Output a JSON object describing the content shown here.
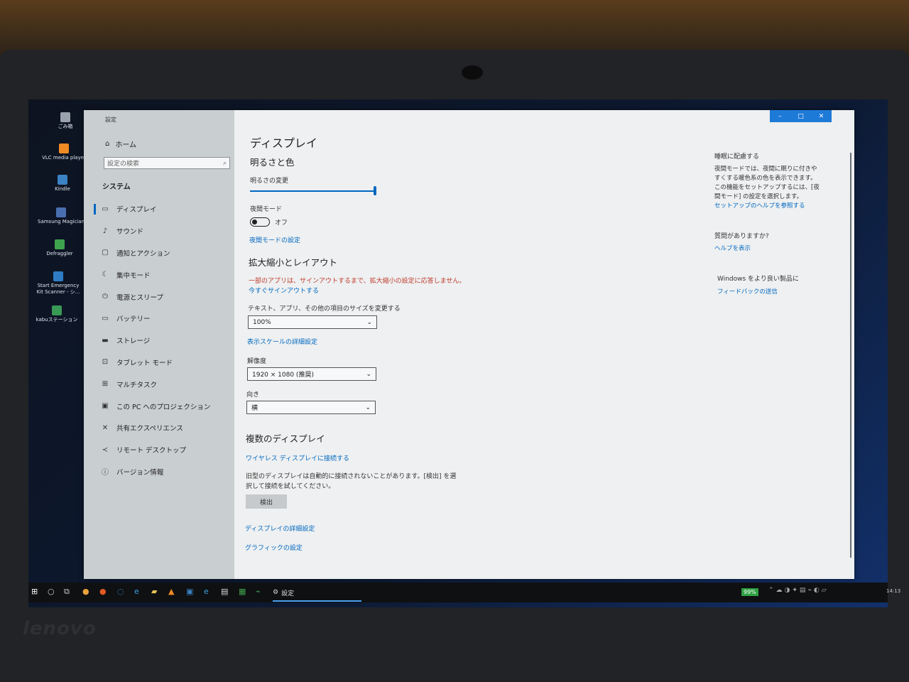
{
  "desktop_icons": [
    {
      "label": "ごみ箱",
      "icon": "recycle-bin-icon"
    },
    {
      "label": "VLC media player",
      "icon": "vlc-icon"
    },
    {
      "label": "Kindle",
      "icon": "kindle-icon"
    },
    {
      "label": "Samsung Magician",
      "icon": "samsung-icon"
    },
    {
      "label": "Defraggler",
      "icon": "defraggler-icon"
    },
    {
      "label": "Start Emergency Kit Scanner - シ...",
      "icon": "scanner-icon"
    },
    {
      "label": "kabuステーション",
      "icon": "kabu-icon"
    }
  ],
  "window": {
    "title": "設定",
    "minimize": "–",
    "maximize": "□",
    "close": "✕"
  },
  "sidebar": {
    "home": "ホーム",
    "search_placeholder": "設定の検索",
    "section": "システム",
    "items": [
      {
        "label": "ディスプレイ",
        "icon": "display-icon"
      },
      {
        "label": "サウンド",
        "icon": "sound-icon"
      },
      {
        "label": "通知とアクション",
        "icon": "notification-icon"
      },
      {
        "label": "集中モード",
        "icon": "focus-moon-icon"
      },
      {
        "label": "電源とスリープ",
        "icon": "power-icon"
      },
      {
        "label": "バッテリー",
        "icon": "battery-icon"
      },
      {
        "label": "ストレージ",
        "icon": "storage-icon"
      },
      {
        "label": "タブレット モード",
        "icon": "tablet-icon"
      },
      {
        "label": "マルチタスク",
        "icon": "multitask-icon"
      },
      {
        "label": "この PC へのプロジェクション",
        "icon": "projection-icon"
      },
      {
        "label": "共有エクスペリエンス",
        "icon": "share-icon"
      },
      {
        "label": "リモート デスクトップ",
        "icon": "remote-icon"
      },
      {
        "label": "バージョン情報",
        "icon": "info-icon"
      }
    ]
  },
  "main": {
    "title": "ディスプレイ",
    "brightness_heading": "明るさと色",
    "brightness_label": "明るさの変更",
    "brightness_value": 1.0,
    "night_label": "夜間モード",
    "night_state": "オフ",
    "night_settings_link": "夜間モードの設定",
    "scale_heading": "拡大縮小とレイアウト",
    "scale_warning": "一部のアプリは、サインアウトするまで、拡大縮小の設定に応答しません。",
    "signout_link": "今すぐサインアウトする",
    "size_label": "テキスト、アプリ、その他の項目のサイズを変更する",
    "size_value": "100%",
    "advanced_scale_link": "表示スケールの詳細設定",
    "resolution_label": "解像度",
    "resolution_value": "1920 × 1080 (推奨)",
    "orientation_label": "向き",
    "orientation_value": "横",
    "multi_heading": "複数のディスプレイ",
    "wireless_link": "ワイヤレス ディスプレイに接続する",
    "multi_text": "旧型のディスプレイは自動的に接続されないことがあります。[検出] を選択して接続を試してください。",
    "detect_button": "検出",
    "advanced_display_link": "ディスプレイの詳細設定",
    "graphics_link": "グラフィックの設定"
  },
  "right_panel": {
    "sleep_heading": "睡眠に配慮する",
    "sleep_text": "夜間モードでは、夜間に眠りに付きやすくする暖色系の色を表示できます。この機能をセットアップするには、[夜間モード] の設定を選択します。",
    "sleep_link": "セットアップのヘルプを参照する",
    "question_heading": "質問がありますか?",
    "help_link": "ヘルプを表示",
    "improve_heading": "Windows をより良い製品に",
    "feedback_link": "フィードバックの送信"
  },
  "taskbar": {
    "active_app": "設定",
    "battery": "99%",
    "time": "14:13"
  },
  "brand": "lenovo"
}
